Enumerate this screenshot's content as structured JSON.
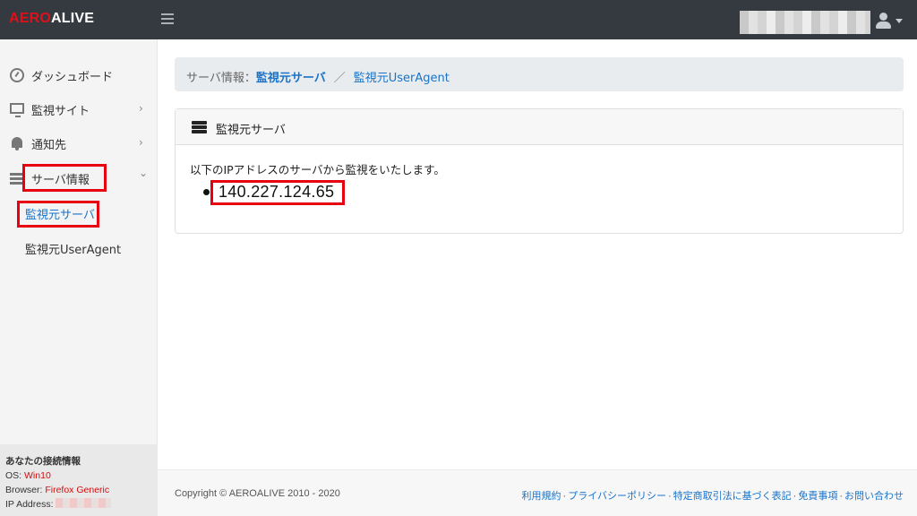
{
  "header": {
    "logo_part1": "AERO",
    "logo_part2": "ALIVE",
    "brand_color": "#e0101a"
  },
  "sidebar": {
    "items": [
      {
        "label": "ダッシュボード",
        "icon": "dashboard-icon"
      },
      {
        "label": "監視サイト",
        "icon": "monitor-icon",
        "chevron": "›"
      },
      {
        "label": "通知先",
        "icon": "bell-icon",
        "chevron": "›"
      },
      {
        "label": "サーバ情報",
        "icon": "server-icon",
        "chevron": "⌄"
      }
    ],
    "sub_items": [
      {
        "label": "監視元サーバ",
        "active": true
      },
      {
        "label": "監視元UserAgent",
        "active": false
      }
    ],
    "connection": {
      "title": "あなたの接続情報",
      "os_label": "OS: ",
      "os_value": "Win10",
      "browser_label": "Browser: ",
      "browser_value": "Firefox Generic",
      "ip_label": "IP Address: "
    }
  },
  "breadcrumb": {
    "static": "サーバ情報：",
    "current": "監視元サーバ",
    "separator": "／",
    "link": "監視元UserAgent"
  },
  "card": {
    "title": "監視元サーバ",
    "description": "以下のIPアドレスのサーバから監視をいたします。",
    "ip_list": [
      "140.227.124.65"
    ]
  },
  "footer": {
    "copyright": "Copyright © AEROALIVE 2010 - 2020",
    "links": [
      "利用規約",
      "プライバシーポリシー",
      "特定商取引法に基づく表記",
      "免責事項",
      "お問い合わせ"
    ],
    "link_separator": "·"
  },
  "colors": {
    "highlight_box": "#e60012",
    "link": "#1a73c8",
    "topbar": "#343a40"
  }
}
